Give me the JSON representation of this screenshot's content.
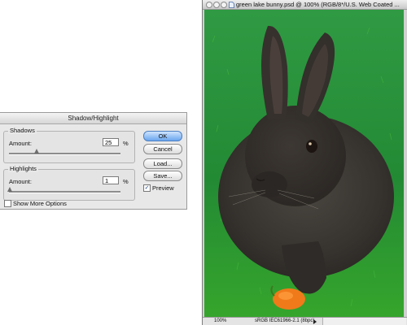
{
  "dialog": {
    "title": "Shadow/Highlight",
    "shadows": {
      "label": "Shadows",
      "amount_label": "Amount:",
      "amount_value": "25",
      "unit": "%",
      "slider_fraction": 0.25
    },
    "highlights": {
      "label": "Highlights",
      "amount_label": "Amount:",
      "amount_value": "1",
      "unit": "%",
      "slider_fraction": 0.01
    },
    "buttons": {
      "ok": "OK",
      "cancel": "Cancel",
      "load": "Load...",
      "save": "Save..."
    },
    "preview": {
      "label": "Preview",
      "checked": true
    },
    "show_more": {
      "label": "Show More Options",
      "checked": false
    }
  },
  "document": {
    "title": "green lake bunny.psd @ 100% (RGB/8*/U.S. Web Coated ...",
    "zoom": "100%",
    "profile": "sRGB IEC61966-2.1 (8bpc)"
  },
  "colors": {
    "grass": "#2a8f3a",
    "rabbit": "#3e3a36",
    "carrot": "#f07a1a",
    "ok_button": "#6aa6ee"
  },
  "icons": {
    "doc_icon": "document-icon",
    "status_menu": "triangle-right-icon"
  }
}
